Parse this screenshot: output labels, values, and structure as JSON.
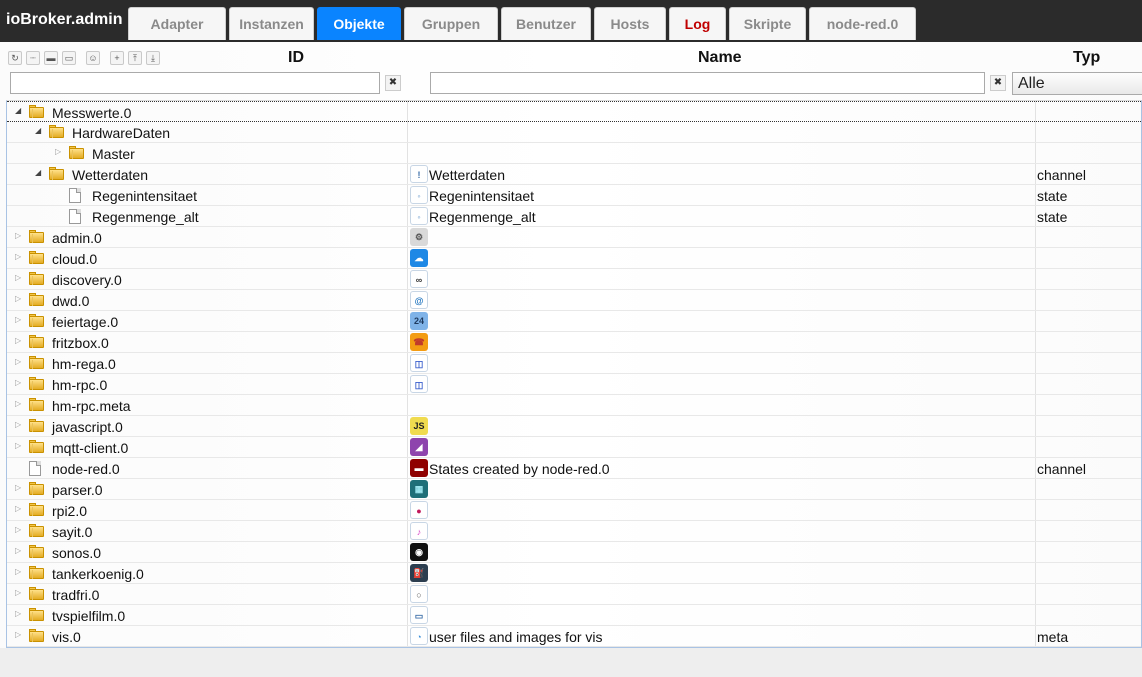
{
  "app": {
    "title": "ioBroker.admin"
  },
  "tabs": [
    {
      "label": "Adapter",
      "state": "normal"
    },
    {
      "label": "Instanzen",
      "state": "normal"
    },
    {
      "label": "Objekte",
      "state": "active"
    },
    {
      "label": "Gruppen",
      "state": "normal"
    },
    {
      "label": "Benutzer",
      "state": "normal"
    },
    {
      "label": "Hosts",
      "state": "normal"
    },
    {
      "label": "Log",
      "state": "alert"
    },
    {
      "label": "Skripte",
      "state": "normal"
    },
    {
      "label": "node-red.0",
      "state": "normal"
    }
  ],
  "toolbar": {
    "buttons": [
      {
        "name": "refresh-icon",
        "glyph": "↻"
      },
      {
        "name": "list-view-icon",
        "glyph": "┈"
      },
      {
        "name": "folder-closed-icon",
        "glyph": "▬"
      },
      {
        "name": "folder-open-icon",
        "glyph": "▭"
      },
      {
        "name": "user-icon",
        "glyph": "☺"
      },
      {
        "name": "add-icon",
        "glyph": "+"
      },
      {
        "name": "upload-icon",
        "glyph": "⤒"
      },
      {
        "name": "download-icon",
        "glyph": "⤓"
      }
    ]
  },
  "columns": {
    "id": "ID",
    "name": "Name",
    "type": "Typ"
  },
  "filters": {
    "id_value": "",
    "name_value": "",
    "clear_glyph": "✖",
    "type_selected": "Alle"
  },
  "rows": [
    {
      "level": 0,
      "expander": "open",
      "kind": "folder",
      "id": "Messwerte.0",
      "icon": "",
      "name": "",
      "type": "",
      "selected": true
    },
    {
      "level": 1,
      "expander": "open",
      "kind": "folder",
      "id": "HardwareDaten",
      "icon": "",
      "name": "",
      "type": ""
    },
    {
      "level": 2,
      "expander": "closed",
      "kind": "folder",
      "id": "Master",
      "icon": "",
      "name": "",
      "type": ""
    },
    {
      "level": 1,
      "expander": "open",
      "kind": "folder",
      "id": "Wetterdaten",
      "icon": "channel-icon",
      "name": "Wetterdaten",
      "type": "channel"
    },
    {
      "level": 2,
      "expander": "none",
      "kind": "file",
      "id": "Regenintensitaet",
      "icon": "state-icon",
      "name": "Regenintensitaet",
      "type": "state"
    },
    {
      "level": 2,
      "expander": "none",
      "kind": "file",
      "id": "Regenmenge_alt",
      "icon": "state-icon",
      "name": "Regenmenge_alt",
      "type": "state"
    },
    {
      "level": 0,
      "expander": "closed",
      "kind": "folder",
      "id": "admin.0",
      "icon": "gear-icon",
      "name": "",
      "type": ""
    },
    {
      "level": 0,
      "expander": "closed",
      "kind": "folder",
      "id": "cloud.0",
      "icon": "cloud-icon",
      "name": "",
      "type": ""
    },
    {
      "level": 0,
      "expander": "closed",
      "kind": "folder",
      "id": "discovery.0",
      "icon": "binoculars-icon",
      "name": "",
      "type": ""
    },
    {
      "level": 0,
      "expander": "closed",
      "kind": "folder",
      "id": "dwd.0",
      "icon": "weather-warning-icon",
      "name": "",
      "type": ""
    },
    {
      "level": 0,
      "expander": "closed",
      "kind": "folder",
      "id": "feiertage.0",
      "icon": "calendar-icon",
      "name": "",
      "type": ""
    },
    {
      "level": 0,
      "expander": "closed",
      "kind": "folder",
      "id": "fritzbox.0",
      "icon": "phone-icon",
      "name": "",
      "type": ""
    },
    {
      "level": 0,
      "expander": "closed",
      "kind": "folder",
      "id": "hm-rega.0",
      "icon": "homematic-icon",
      "name": "",
      "type": ""
    },
    {
      "level": 0,
      "expander": "closed",
      "kind": "folder",
      "id": "hm-rpc.0",
      "icon": "homematic-icon",
      "name": "",
      "type": ""
    },
    {
      "level": 0,
      "expander": "closed",
      "kind": "folder",
      "id": "hm-rpc.meta",
      "icon": "",
      "name": "",
      "type": ""
    },
    {
      "level": 0,
      "expander": "closed",
      "kind": "folder",
      "id": "javascript.0",
      "icon": "javascript-icon",
      "name": "",
      "type": ""
    },
    {
      "level": 0,
      "expander": "closed",
      "kind": "folder",
      "id": "mqtt-client.0",
      "icon": "mqtt-client-icon",
      "name": "",
      "type": ""
    },
    {
      "level": 0,
      "expander": "none",
      "kind": "file",
      "id": "node-red.0",
      "icon": "node-red-icon",
      "name": "States created by node-red.0",
      "type": "channel"
    },
    {
      "level": 0,
      "expander": "closed",
      "kind": "folder",
      "id": "parser.0",
      "icon": "parser-icon",
      "name": "",
      "type": ""
    },
    {
      "level": 0,
      "expander": "closed",
      "kind": "folder",
      "id": "rpi2.0",
      "icon": "raspberry-icon",
      "name": "",
      "type": ""
    },
    {
      "level": 0,
      "expander": "closed",
      "kind": "folder",
      "id": "sayit.0",
      "icon": "sayit-icon",
      "name": "",
      "type": ""
    },
    {
      "level": 0,
      "expander": "closed",
      "kind": "folder",
      "id": "sonos.0",
      "icon": "sonos-icon",
      "name": "",
      "type": ""
    },
    {
      "level": 0,
      "expander": "closed",
      "kind": "folder",
      "id": "tankerkoenig.0",
      "icon": "fuel-pump-icon",
      "name": "",
      "type": ""
    },
    {
      "level": 0,
      "expander": "closed",
      "kind": "folder",
      "id": "tradfri.0",
      "icon": "tradfri-icon",
      "name": "",
      "type": ""
    },
    {
      "level": 0,
      "expander": "closed",
      "kind": "folder",
      "id": "tvspielfilm.0",
      "icon": "tv-icon",
      "name": "",
      "type": ""
    },
    {
      "level": 0,
      "expander": "closed",
      "kind": "folder",
      "id": "vis.0",
      "icon": "vis-icon",
      "name": "user files and images for vis",
      "type": "meta"
    }
  ],
  "icon_glyphs": {
    "channel-icon": "!",
    "state-icon": "◦",
    "gear-icon": "⚙",
    "cloud-icon": "☁",
    "binoculars-icon": "∞",
    "weather-warning-icon": "@",
    "calendar-icon": "24",
    "phone-icon": "☎",
    "homematic-icon": "◫",
    "javascript-icon": "JS",
    "mqtt-client-icon": "◢",
    "node-red-icon": "▬",
    "parser-icon": "▦",
    "raspberry-icon": "●",
    "sayit-icon": "♪",
    "sonos-icon": "◉",
    "fuel-pump-icon": "⛽",
    "tradfri-icon": "○",
    "tv-icon": "▭",
    "vis-icon": "◔"
  },
  "icon_colors": {
    "channel-icon": "#ffffff",
    "state-icon": "#ffffff",
    "gear-icon": "#d9d9d9",
    "cloud-icon": "#1e88e5",
    "binoculars-icon": "#ffffff",
    "weather-warning-icon": "#ffffff",
    "calendar-icon": "#7fb3e8",
    "phone-icon": "#f39c12",
    "homematic-icon": "#ffffff",
    "javascript-icon": "#f0db4f",
    "mqtt-client-icon": "#8e44ad",
    "node-red-icon": "#8f0000",
    "parser-icon": "#1f6f78",
    "raspberry-icon": "#ffffff",
    "sayit-icon": "#ffffff",
    "sonos-icon": "#111111",
    "fuel-pump-icon": "#2c3e50",
    "tradfri-icon": "#ffffff",
    "tv-icon": "#ffffff",
    "vis-icon": "#ffffff"
  },
  "icon_fg": {
    "channel-icon": "#3b6ea8",
    "state-icon": "#5a8fc7",
    "gear-icon": "#555555",
    "cloud-icon": "#ffffff",
    "binoculars-icon": "#333333",
    "weather-warning-icon": "#1e73be",
    "calendar-icon": "#1e3a5f",
    "phone-icon": "#c0392b",
    "homematic-icon": "#3a5fcd",
    "javascript-icon": "#222222",
    "mqtt-client-icon": "#ffffff",
    "node-red-icon": "#ffffff",
    "parser-icon": "#9ee7f0",
    "raspberry-icon": "#c2185b",
    "sayit-icon": "#d63fc4",
    "sonos-icon": "#ffffff",
    "fuel-pump-icon": "#ffffff",
    "tradfri-icon": "#555555",
    "tv-icon": "#3b6ea8",
    "vis-icon": "#3b8fd9"
  }
}
